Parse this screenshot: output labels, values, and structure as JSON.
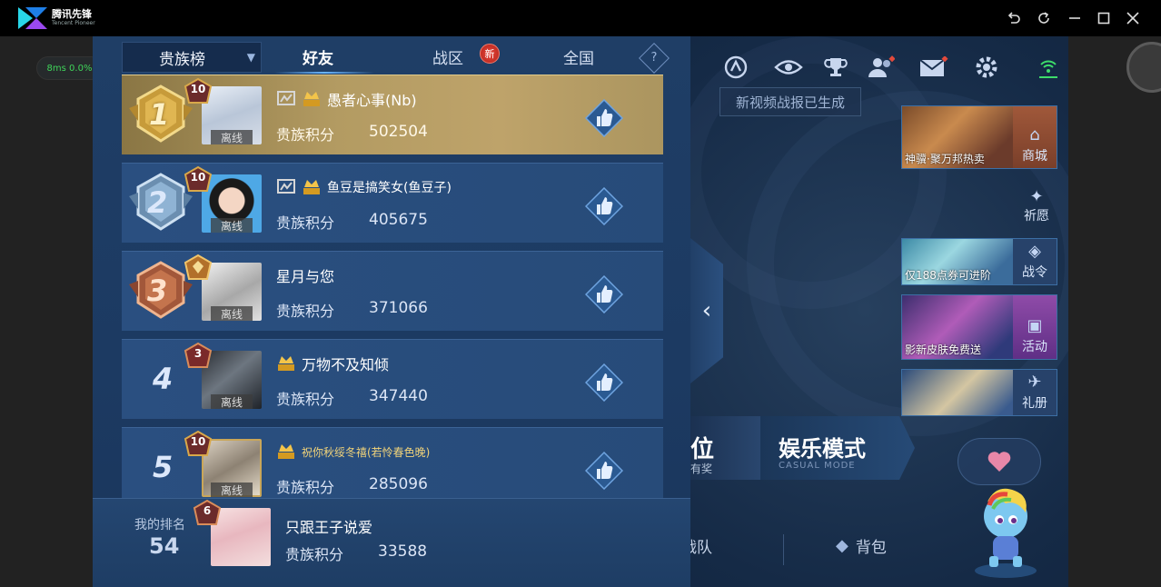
{
  "emulator": {
    "brand": "腾讯先锋",
    "brand_sub": "Tencent Pioneer",
    "fps": "8ms  0.0%"
  },
  "game": {
    "notice": "新视频战报已生成",
    "promos": [
      {
        "caption": "神骥·聚万邦热卖",
        "side": "商城",
        "icon": "shop-icon"
      },
      {
        "caption": "仅188点券可进阶",
        "side": "战令",
        "icon": "battle-pass-icon"
      },
      {
        "caption": "影新皮肤免费送",
        "side": "活动",
        "icon": "activity-icon"
      },
      {
        "caption": "",
        "side": "礼册",
        "icon": "gift-book-icon"
      }
    ],
    "wish": "祈愿",
    "rank_mode": {
      "title": "位",
      "sub": "有奖"
    },
    "casual_mode": {
      "title": "娱乐模式",
      "sub": "CASUAL MODE"
    },
    "bottom_nav": {
      "team": "战队",
      "bag": "背包"
    }
  },
  "leaderboard": {
    "dropdown": "贵族榜",
    "tabs": [
      "好友",
      "战区",
      "全国"
    ],
    "new_badge": "新",
    "help": "?",
    "score_label": "贵族积分",
    "offline": "离线",
    "entries": [
      {
        "rank": "1",
        "vip_level": "10",
        "name": "愚者心事(Nb)",
        "score": "502504",
        "svip": true,
        "frame": true
      },
      {
        "rank": "2",
        "vip_level": "10",
        "name": "鱼豆是搞笑女(鱼豆子)",
        "score": "405675",
        "svip": true,
        "frame": true
      },
      {
        "rank": "3",
        "vip_level": "",
        "name": "星月与您",
        "score": "371066",
        "svip": false,
        "frame": false
      },
      {
        "rank": "4",
        "vip_level": "3",
        "name": "万物不及知倾",
        "score": "347440",
        "svip": true,
        "frame": false
      },
      {
        "rank": "5",
        "vip_level": "10",
        "name": "祝你秋绥冬禧(若怜春色晚)",
        "score": "285096",
        "svip": true,
        "frame": false
      }
    ],
    "me": {
      "label": "我的排名",
      "rank": "54",
      "vip_level": "6",
      "name": "只跟王子说爱",
      "score": "33588"
    }
  }
}
